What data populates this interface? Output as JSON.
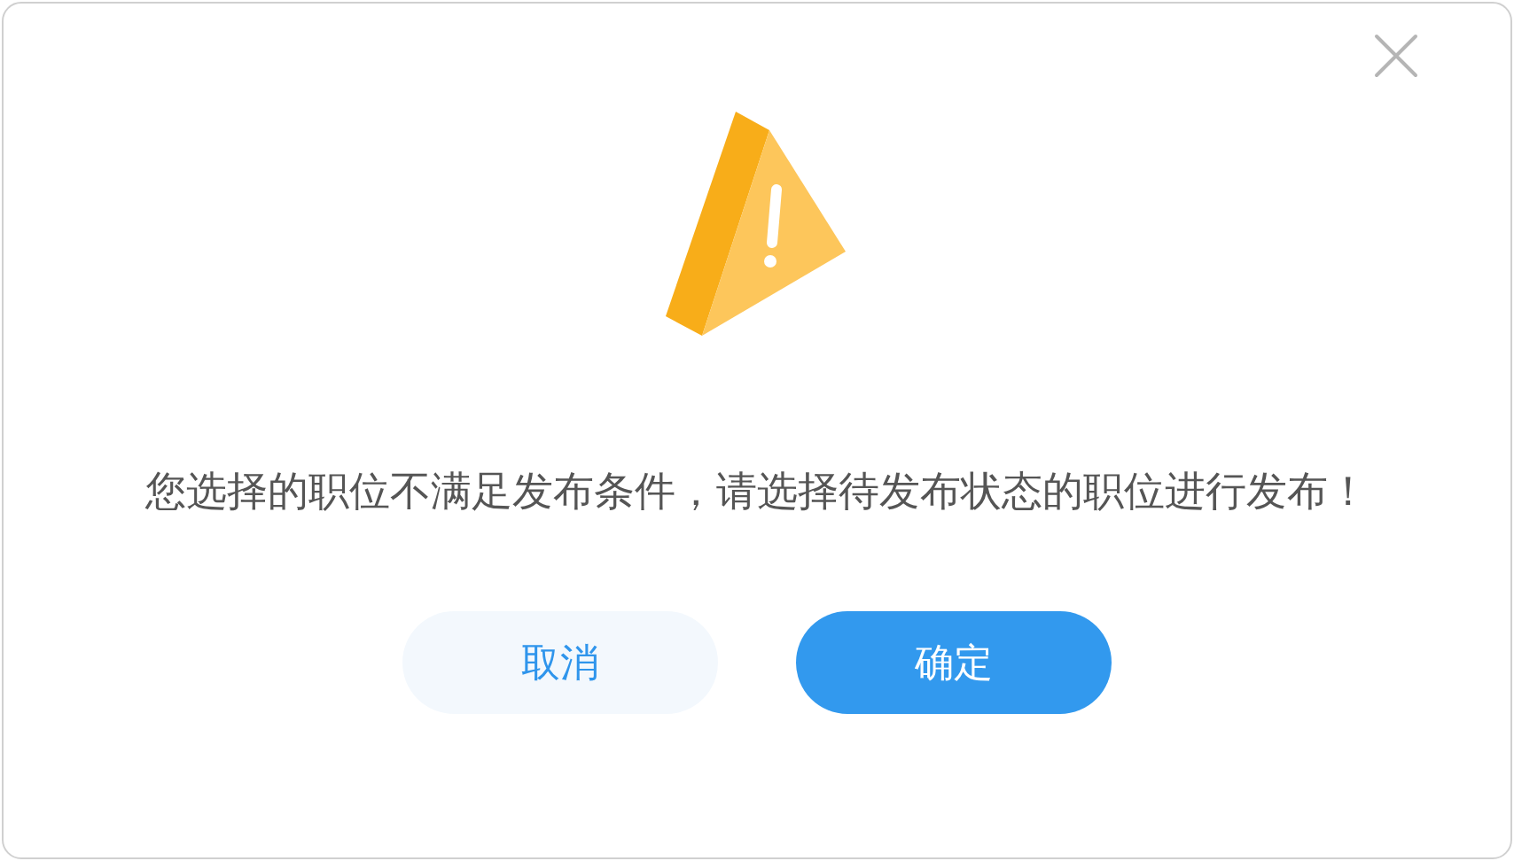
{
  "dialog": {
    "message": "您选择的职位不满足发布条件，请选择待发布状态的职位进行发布！",
    "buttons": [
      {
        "label": "取消",
        "kind": "secondary"
      },
      {
        "label": "确定",
        "kind": "primary"
      }
    ]
  }
}
